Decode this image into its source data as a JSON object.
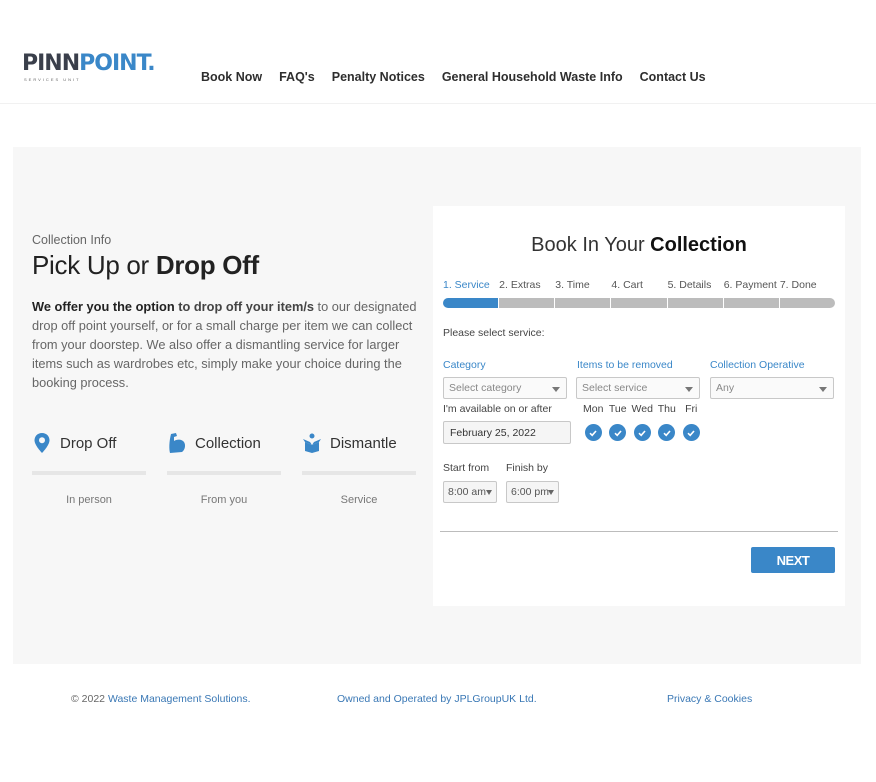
{
  "logo": {
    "part1": "PINN",
    "part2": "POINT.",
    "subtitle": "SERVICES UNIT"
  },
  "nav": [
    "Book Now",
    "FAQ's",
    "Penalty Notices",
    "General Household Waste Info",
    "Contact Us"
  ],
  "info": {
    "eyebrow": "Collection Info",
    "headline_a": "Pick Up or ",
    "headline_b": "Drop Off",
    "intro_bold": "We offer you the option",
    "intro_mid": " to drop off your item/s",
    "intro_rest": " to our designated drop off point yourself, or for a small charge per item we can collect from your doorstep. We also offer a dismantling service for larger items such as wardrobes etc, simply make your choice during the booking process."
  },
  "features": [
    {
      "title": "Drop Off",
      "sub": "In person",
      "icon": "location-pin-icon"
    },
    {
      "title": "Collection",
      "sub": "From you",
      "icon": "muscle-arm-icon"
    },
    {
      "title": "Dismantle",
      "sub": "Service",
      "icon": "open-box-icon"
    }
  ],
  "booking": {
    "title_a": "Book In Your ",
    "title_b": "Collection",
    "steps": [
      "1. Service",
      "2. Extras",
      "3. Time",
      "4. Cart",
      "5. Details",
      "6. Payment",
      "7. Done"
    ],
    "active_step": 0,
    "please_select": "Please select service:",
    "category_label": "Category",
    "category_placeholder": "Select category",
    "items_label": "Items to be removed",
    "items_placeholder": "Select service",
    "operative_label": "Collection Operative",
    "operative_value": "Any",
    "available_label": "I'm available on or after",
    "date_value": "February 25, 2022",
    "days": [
      "Mon",
      "Tue",
      "Wed",
      "Thu",
      "Fri"
    ],
    "start_label": "Start from",
    "start_value": "8:00 am",
    "finish_label": "Finish by",
    "finish_value": "6:00 pm",
    "next_label": "NEXT"
  },
  "footer": {
    "copyright_prefix": "© 2022 ",
    "company_link": "Waste Management Solutions.",
    "operated": "Owned and Operated by JPLGroupUK Ltd.",
    "privacy": "Privacy & Cookies"
  },
  "colors": {
    "accent": "#3a87c8",
    "panel_bg": "#f7f7f7",
    "step_inactive": "#bcbcbc"
  }
}
